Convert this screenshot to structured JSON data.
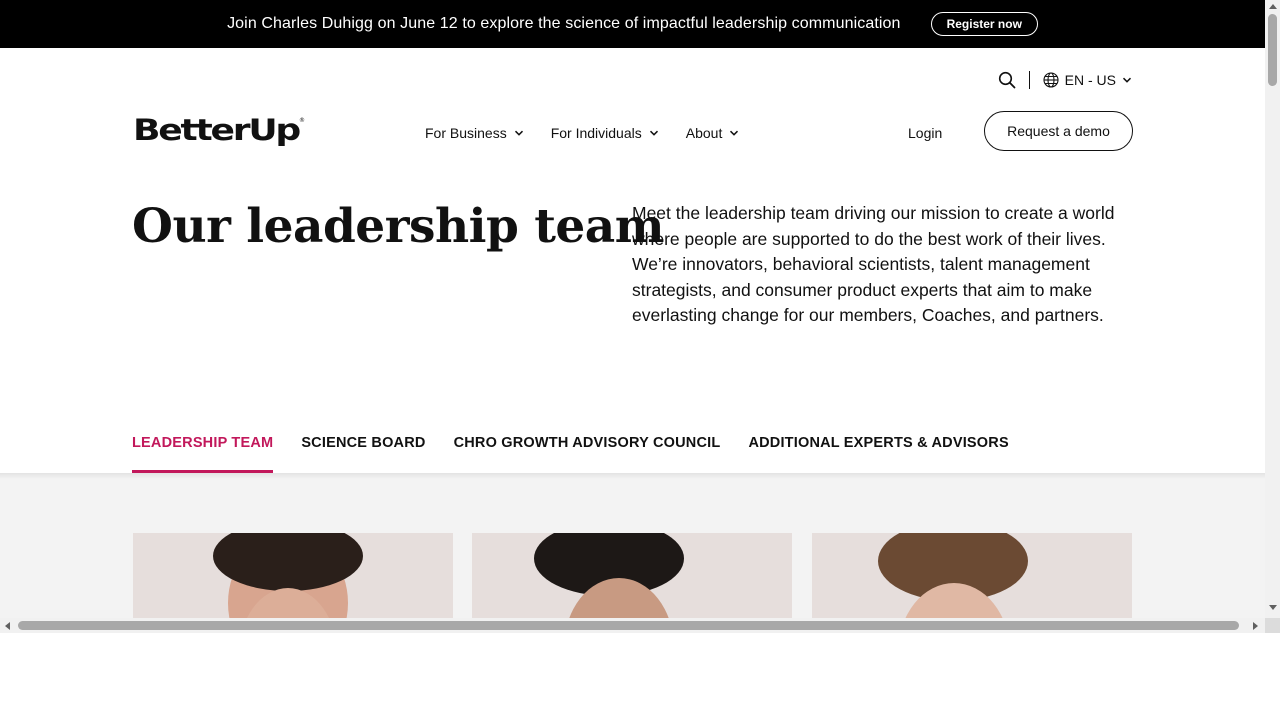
{
  "announcement": {
    "text": "Join Charles Duhigg on June 12 to explore the science of impactful leadership communication",
    "cta": "Register now"
  },
  "utility": {
    "search_icon": "search-icon",
    "language_icon": "globe-icon",
    "language": "EN - US"
  },
  "brand": {
    "logo_text": "BetterUp",
    "trademark": "®"
  },
  "nav": {
    "items": [
      {
        "label": "For Business"
      },
      {
        "label": "For Individuals"
      },
      {
        "label": "About"
      }
    ],
    "login": "Login",
    "demo": "Request a demo"
  },
  "hero": {
    "title": "Our leadership team",
    "description": "Meet the leadership team driving our mission to create a world where people are supported to do the best work of their lives. We’re innovators, behavioral scientists, talent management strategists, and consumer product experts that aim to make everlasting change for our members, Coaches, and partners."
  },
  "tabs": [
    {
      "label": "LEADERSHIP TEAM",
      "active": true
    },
    {
      "label": "SCIENCE BOARD",
      "active": false
    },
    {
      "label": "CHRO GROWTH ADVISORY COUNCIL",
      "active": false
    },
    {
      "label": "ADDITIONAL EXPERTS & ADVISORS",
      "active": false
    }
  ],
  "colors": {
    "accent": "#c2185b",
    "announcement_bg": "#000000",
    "team_bg": "#f3f3f3",
    "card_bg": "#e6dedc"
  }
}
